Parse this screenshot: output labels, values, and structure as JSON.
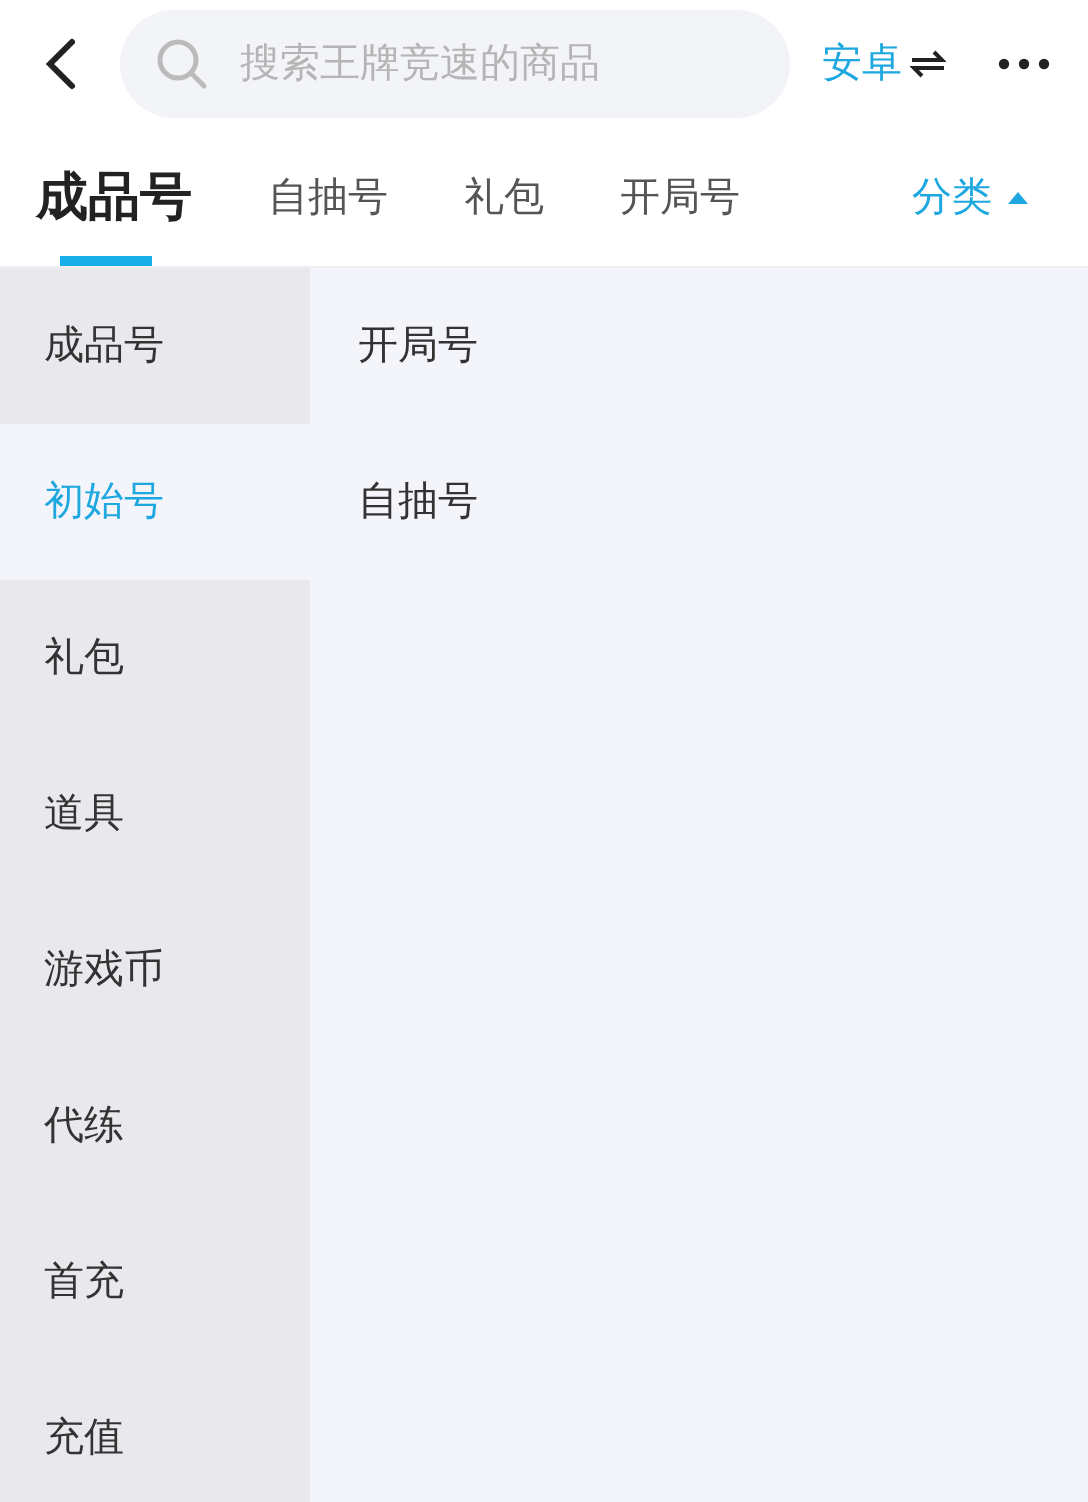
{
  "search": {
    "placeholder": "搜索王牌竞速的商品"
  },
  "platform": {
    "label": "安卓"
  },
  "tabs": [
    {
      "label": "成品号",
      "selected": true
    },
    {
      "label": "自抽号",
      "selected": false
    },
    {
      "label": "礼包",
      "selected": false
    },
    {
      "label": "开局号",
      "selected": false
    }
  ],
  "category_button": {
    "label": "分类"
  },
  "sidebar": {
    "items": [
      {
        "label": "成品号",
        "selected": false
      },
      {
        "label": "初始号",
        "selected": true
      },
      {
        "label": "礼包",
        "selected": false
      },
      {
        "label": "道具",
        "selected": false
      },
      {
        "label": "游戏币",
        "selected": false
      },
      {
        "label": "代练",
        "selected": false
      },
      {
        "label": "首充",
        "selected": false
      },
      {
        "label": "充值",
        "selected": false
      }
    ]
  },
  "subcategories": [
    {
      "label": "开局号"
    },
    {
      "label": "自抽号"
    }
  ]
}
